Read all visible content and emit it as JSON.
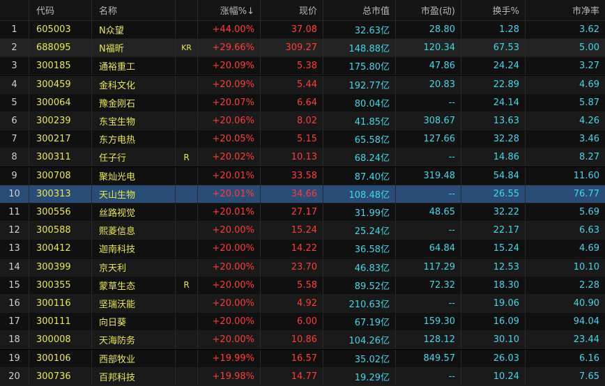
{
  "colors": {
    "up": "#ff3b3b",
    "value": "#3fd8e6",
    "code": "#e8e84a",
    "selected_row": "#2a4d78"
  },
  "selected_index": 10,
  "headers": {
    "idx": "",
    "code": "代码",
    "name": "名称",
    "tag": "",
    "pct": "涨幅%↓",
    "price": "现价",
    "cap": "总市值",
    "pe": "市盈(动)",
    "turnover": "换手%",
    "pb": "市净率"
  },
  "rows": [
    {
      "idx": "1",
      "code": "605003",
      "name": "N众望",
      "tag": "",
      "pct": "+44.00%",
      "price": "37.08",
      "cap": "32.63亿",
      "pe": "28.80",
      "turnover": "1.28",
      "pb": "3.62"
    },
    {
      "idx": "2",
      "code": "688095",
      "name": "N福昕",
      "tag": "KR",
      "pct": "+29.66%",
      "price": "309.27",
      "cap": "148.88亿",
      "pe": "120.34",
      "turnover": "67.53",
      "pb": "5.00"
    },
    {
      "idx": "3",
      "code": "300185",
      "name": "通裕重工",
      "tag": "",
      "pct": "+20.09%",
      "price": "5.38",
      "cap": "175.80亿",
      "pe": "47.86",
      "turnover": "24.24",
      "pb": "3.27"
    },
    {
      "idx": "4",
      "code": "300459",
      "name": "金科文化",
      "tag": "",
      "pct": "+20.09%",
      "price": "5.44",
      "cap": "192.77亿",
      "pe": "20.83",
      "turnover": "22.89",
      "pb": "4.69"
    },
    {
      "idx": "5",
      "code": "300064",
      "name": "豫金刚石",
      "tag": "",
      "pct": "+20.07%",
      "price": "6.64",
      "cap": "80.04亿",
      "pe": "--",
      "turnover": "24.14",
      "pb": "5.87"
    },
    {
      "idx": "6",
      "code": "300239",
      "name": "东宝生物",
      "tag": "",
      "pct": "+20.06%",
      "price": "8.02",
      "cap": "41.85亿",
      "pe": "308.67",
      "turnover": "13.63",
      "pb": "4.26"
    },
    {
      "idx": "7",
      "code": "300217",
      "name": "东方电热",
      "tag": "",
      "pct": "+20.05%",
      "price": "5.15",
      "cap": "65.58亿",
      "pe": "127.66",
      "turnover": "32.28",
      "pb": "3.46"
    },
    {
      "idx": "8",
      "code": "300311",
      "name": "任子行",
      "tag": "R",
      "pct": "+20.02%",
      "price": "10.13",
      "cap": "68.24亿",
      "pe": "--",
      "turnover": "14.86",
      "pb": "8.27"
    },
    {
      "idx": "9",
      "code": "300708",
      "name": "聚灿光电",
      "tag": "",
      "pct": "+20.01%",
      "price": "33.58",
      "cap": "87.40亿",
      "pe": "319.48",
      "turnover": "54.84",
      "pb": "11.60"
    },
    {
      "idx": "10",
      "code": "300313",
      "name": "天山生物",
      "tag": "",
      "pct": "+20.01%",
      "price": "34.66",
      "cap": "108.48亿",
      "pe": "--",
      "turnover": "26.55",
      "pb": "76.77"
    },
    {
      "idx": "11",
      "code": "300556",
      "name": "丝路视觉",
      "tag": "",
      "pct": "+20.01%",
      "price": "27.17",
      "cap": "31.99亿",
      "pe": "48.65",
      "turnover": "32.22",
      "pb": "5.69"
    },
    {
      "idx": "12",
      "code": "300588",
      "name": "熙菱信息",
      "tag": "",
      "pct": "+20.00%",
      "price": "15.24",
      "cap": "25.24亿",
      "pe": "--",
      "turnover": "22.17",
      "pb": "6.63"
    },
    {
      "idx": "13",
      "code": "300412",
      "name": "迦南科技",
      "tag": "",
      "pct": "+20.00%",
      "price": "14.22",
      "cap": "36.58亿",
      "pe": "64.84",
      "turnover": "15.24",
      "pb": "4.69"
    },
    {
      "idx": "14",
      "code": "300399",
      "name": "京天利",
      "tag": "",
      "pct": "+20.00%",
      "price": "23.70",
      "cap": "46.83亿",
      "pe": "117.29",
      "turnover": "12.53",
      "pb": "10.10"
    },
    {
      "idx": "15",
      "code": "300355",
      "name": "蒙草生态",
      "tag": "R",
      "pct": "+20.00%",
      "price": "5.58",
      "cap": "89.52亿",
      "pe": "72.32",
      "turnover": "18.30",
      "pb": "2.28"
    },
    {
      "idx": "16",
      "code": "300116",
      "name": "坚瑞沃能",
      "tag": "",
      "pct": "+20.00%",
      "price": "4.92",
      "cap": "210.63亿",
      "pe": "--",
      "turnover": "19.06",
      "pb": "40.90"
    },
    {
      "idx": "17",
      "code": "300111",
      "name": "向日葵",
      "tag": "",
      "pct": "+20.00%",
      "price": "6.00",
      "cap": "67.19亿",
      "pe": "159.30",
      "turnover": "16.09",
      "pb": "94.04"
    },
    {
      "idx": "18",
      "code": "300008",
      "name": "天海防务",
      "tag": "",
      "pct": "+20.00%",
      "price": "10.86",
      "cap": "104.26亿",
      "pe": "128.12",
      "turnover": "30.10",
      "pb": "23.44"
    },
    {
      "idx": "19",
      "code": "300106",
      "name": "西部牧业",
      "tag": "",
      "pct": "+19.99%",
      "price": "16.57",
      "cap": "35.02亿",
      "pe": "849.57",
      "turnover": "26.03",
      "pb": "6.16"
    },
    {
      "idx": "20",
      "code": "300736",
      "name": "百邦科技",
      "tag": "",
      "pct": "+19.98%",
      "price": "14.77",
      "cap": "19.29亿",
      "pe": "--",
      "turnover": "10.24",
      "pb": "7.65"
    }
  ]
}
